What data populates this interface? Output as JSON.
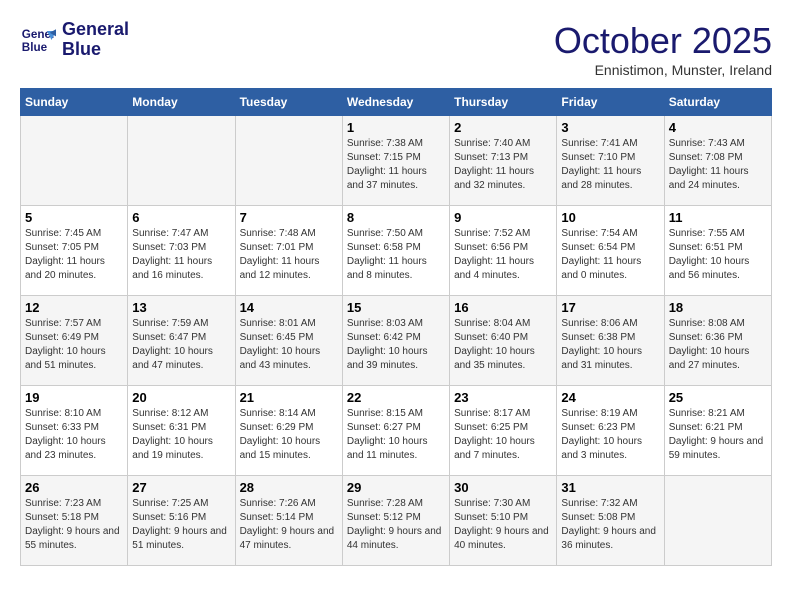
{
  "logo": {
    "line1": "General",
    "line2": "Blue"
  },
  "title": "October 2025",
  "subtitle": "Ennistimon, Munster, Ireland",
  "weekdays": [
    "Sunday",
    "Monday",
    "Tuesday",
    "Wednesday",
    "Thursday",
    "Friday",
    "Saturday"
  ],
  "weeks": [
    [
      {
        "day": "",
        "info": ""
      },
      {
        "day": "",
        "info": ""
      },
      {
        "day": "",
        "info": ""
      },
      {
        "day": "1",
        "info": "Sunrise: 7:38 AM\nSunset: 7:15 PM\nDaylight: 11 hours\nand 37 minutes."
      },
      {
        "day": "2",
        "info": "Sunrise: 7:40 AM\nSunset: 7:13 PM\nDaylight: 11 hours\nand 32 minutes."
      },
      {
        "day": "3",
        "info": "Sunrise: 7:41 AM\nSunset: 7:10 PM\nDaylight: 11 hours\nand 28 minutes."
      },
      {
        "day": "4",
        "info": "Sunrise: 7:43 AM\nSunset: 7:08 PM\nDaylight: 11 hours\nand 24 minutes."
      }
    ],
    [
      {
        "day": "5",
        "info": "Sunrise: 7:45 AM\nSunset: 7:05 PM\nDaylight: 11 hours\nand 20 minutes."
      },
      {
        "day": "6",
        "info": "Sunrise: 7:47 AM\nSunset: 7:03 PM\nDaylight: 11 hours\nand 16 minutes."
      },
      {
        "day": "7",
        "info": "Sunrise: 7:48 AM\nSunset: 7:01 PM\nDaylight: 11 hours\nand 12 minutes."
      },
      {
        "day": "8",
        "info": "Sunrise: 7:50 AM\nSunset: 6:58 PM\nDaylight: 11 hours\nand 8 minutes."
      },
      {
        "day": "9",
        "info": "Sunrise: 7:52 AM\nSunset: 6:56 PM\nDaylight: 11 hours\nand 4 minutes."
      },
      {
        "day": "10",
        "info": "Sunrise: 7:54 AM\nSunset: 6:54 PM\nDaylight: 11 hours\nand 0 minutes."
      },
      {
        "day": "11",
        "info": "Sunrise: 7:55 AM\nSunset: 6:51 PM\nDaylight: 10 hours\nand 56 minutes."
      }
    ],
    [
      {
        "day": "12",
        "info": "Sunrise: 7:57 AM\nSunset: 6:49 PM\nDaylight: 10 hours\nand 51 minutes."
      },
      {
        "day": "13",
        "info": "Sunrise: 7:59 AM\nSunset: 6:47 PM\nDaylight: 10 hours\nand 47 minutes."
      },
      {
        "day": "14",
        "info": "Sunrise: 8:01 AM\nSunset: 6:45 PM\nDaylight: 10 hours\nand 43 minutes."
      },
      {
        "day": "15",
        "info": "Sunrise: 8:03 AM\nSunset: 6:42 PM\nDaylight: 10 hours\nand 39 minutes."
      },
      {
        "day": "16",
        "info": "Sunrise: 8:04 AM\nSunset: 6:40 PM\nDaylight: 10 hours\nand 35 minutes."
      },
      {
        "day": "17",
        "info": "Sunrise: 8:06 AM\nSunset: 6:38 PM\nDaylight: 10 hours\nand 31 minutes."
      },
      {
        "day": "18",
        "info": "Sunrise: 8:08 AM\nSunset: 6:36 PM\nDaylight: 10 hours\nand 27 minutes."
      }
    ],
    [
      {
        "day": "19",
        "info": "Sunrise: 8:10 AM\nSunset: 6:33 PM\nDaylight: 10 hours\nand 23 minutes."
      },
      {
        "day": "20",
        "info": "Sunrise: 8:12 AM\nSunset: 6:31 PM\nDaylight: 10 hours\nand 19 minutes."
      },
      {
        "day": "21",
        "info": "Sunrise: 8:14 AM\nSunset: 6:29 PM\nDaylight: 10 hours\nand 15 minutes."
      },
      {
        "day": "22",
        "info": "Sunrise: 8:15 AM\nSunset: 6:27 PM\nDaylight: 10 hours\nand 11 minutes."
      },
      {
        "day": "23",
        "info": "Sunrise: 8:17 AM\nSunset: 6:25 PM\nDaylight: 10 hours\nand 7 minutes."
      },
      {
        "day": "24",
        "info": "Sunrise: 8:19 AM\nSunset: 6:23 PM\nDaylight: 10 hours\nand 3 minutes."
      },
      {
        "day": "25",
        "info": "Sunrise: 8:21 AM\nSunset: 6:21 PM\nDaylight: 9 hours\nand 59 minutes."
      }
    ],
    [
      {
        "day": "26",
        "info": "Sunrise: 7:23 AM\nSunset: 5:18 PM\nDaylight: 9 hours\nand 55 minutes."
      },
      {
        "day": "27",
        "info": "Sunrise: 7:25 AM\nSunset: 5:16 PM\nDaylight: 9 hours\nand 51 minutes."
      },
      {
        "day": "28",
        "info": "Sunrise: 7:26 AM\nSunset: 5:14 PM\nDaylight: 9 hours\nand 47 minutes."
      },
      {
        "day": "29",
        "info": "Sunrise: 7:28 AM\nSunset: 5:12 PM\nDaylight: 9 hours\nand 44 minutes."
      },
      {
        "day": "30",
        "info": "Sunrise: 7:30 AM\nSunset: 5:10 PM\nDaylight: 9 hours\nand 40 minutes."
      },
      {
        "day": "31",
        "info": "Sunrise: 7:32 AM\nSunset: 5:08 PM\nDaylight: 9 hours\nand 36 minutes."
      },
      {
        "day": "",
        "info": ""
      }
    ]
  ]
}
